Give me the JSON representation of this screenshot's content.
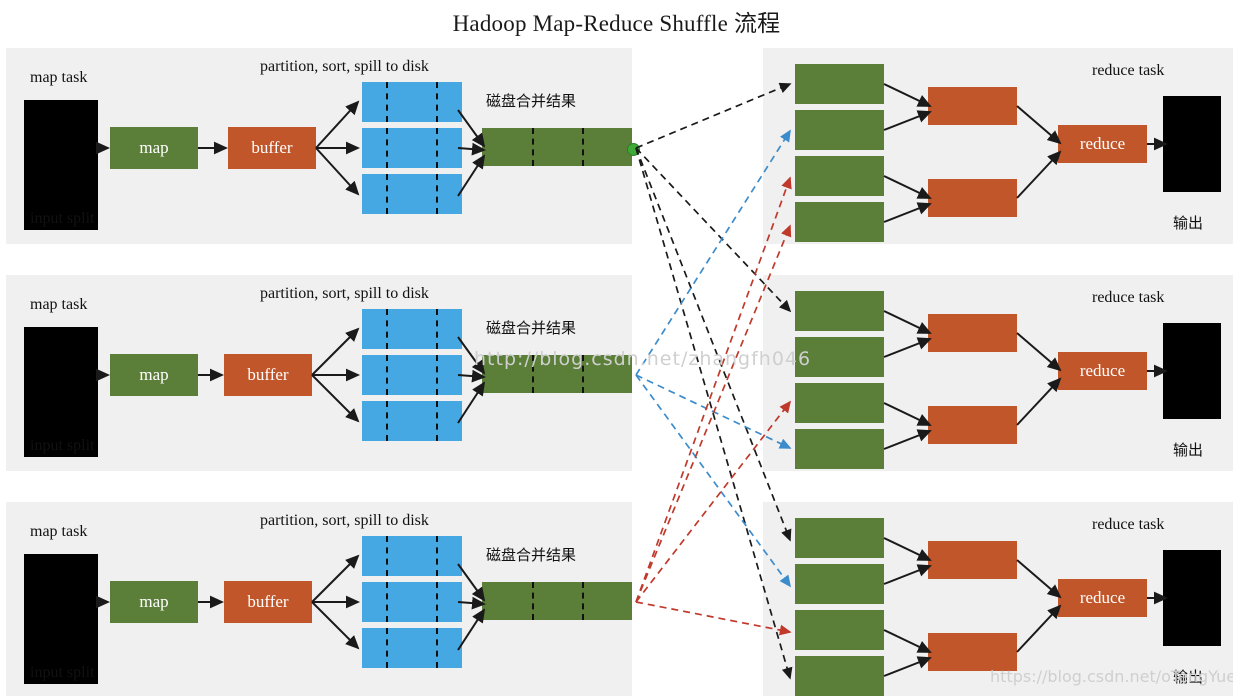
{
  "title": "Hadoop Map-Reduce Shuffle 流程",
  "colors": {
    "panel_bg": "#f0f0f0",
    "green": "#5b7f38",
    "orange": "#c0562a",
    "blue": "#45a8e2",
    "black": "#000000",
    "dot_green": "#3faa35",
    "arrow_black": "#1a1a1a",
    "arrow_blue": "#3c8ccc",
    "arrow_red": "#c0392b",
    "watermark": "#cfcfcf"
  },
  "labels": {
    "map_task": "map task",
    "input_split": "input split",
    "partition_sort_spill": "partition, sort, spill to disk",
    "disk_merge_result": "磁盘合并结果",
    "map_box": "map",
    "buffer_box": "buffer",
    "reduce_task": "reduce task",
    "reduce_box": "reduce",
    "output": "输出"
  },
  "map_tasks": [
    {
      "id": "map-task-1",
      "map_task_label": "map task",
      "input_split_label": "input split",
      "spill_label": "partition, sort, spill to disk",
      "merge_label": "磁盘合并结果",
      "map_label": "map",
      "buffer_label": "buffer",
      "spill_count": 3,
      "partitions_per_spill": 3,
      "merge_partitions": 3,
      "fan_color": "#1a1a1a"
    },
    {
      "id": "map-task-2",
      "map_task_label": "map task",
      "input_split_label": "input split",
      "spill_label": "partition, sort, spill to disk",
      "merge_label": "磁盘合并结果",
      "map_label": "map",
      "buffer_label": "buffer",
      "spill_count": 3,
      "partitions_per_spill": 3,
      "merge_partitions": 3,
      "fan_color": "#3c8ccc"
    },
    {
      "id": "map-task-3",
      "map_task_label": "map task",
      "input_split_label": "input split",
      "spill_label": "partition, sort, spill to disk",
      "merge_label": "磁盘合并结果",
      "map_label": "map",
      "buffer_label": "buffer",
      "spill_count": 3,
      "partitions_per_spill": 3,
      "merge_partitions": 3,
      "fan_color": "#c0392b"
    }
  ],
  "reduce_tasks": [
    {
      "id": "reduce-task-1",
      "reduce_task_label": "reduce task",
      "reduce_label": "reduce",
      "output_label": "输出",
      "copy_box_count": 4,
      "merge_box_count": 2
    },
    {
      "id": "reduce-task-2",
      "reduce_task_label": "reduce task",
      "reduce_label": "reduce",
      "output_label": "输出",
      "copy_box_count": 4,
      "merge_box_count": 2
    },
    {
      "id": "reduce-task-3",
      "reduce_task_label": "reduce task",
      "reduce_label": "reduce",
      "output_label": "输出",
      "copy_box_count": 4,
      "merge_box_count": 2
    }
  ],
  "watermarks": {
    "center": "http://blog.csdn.net/zhangfh046",
    "bottom_right": "https://blog.csdn.net/oTengYue"
  }
}
